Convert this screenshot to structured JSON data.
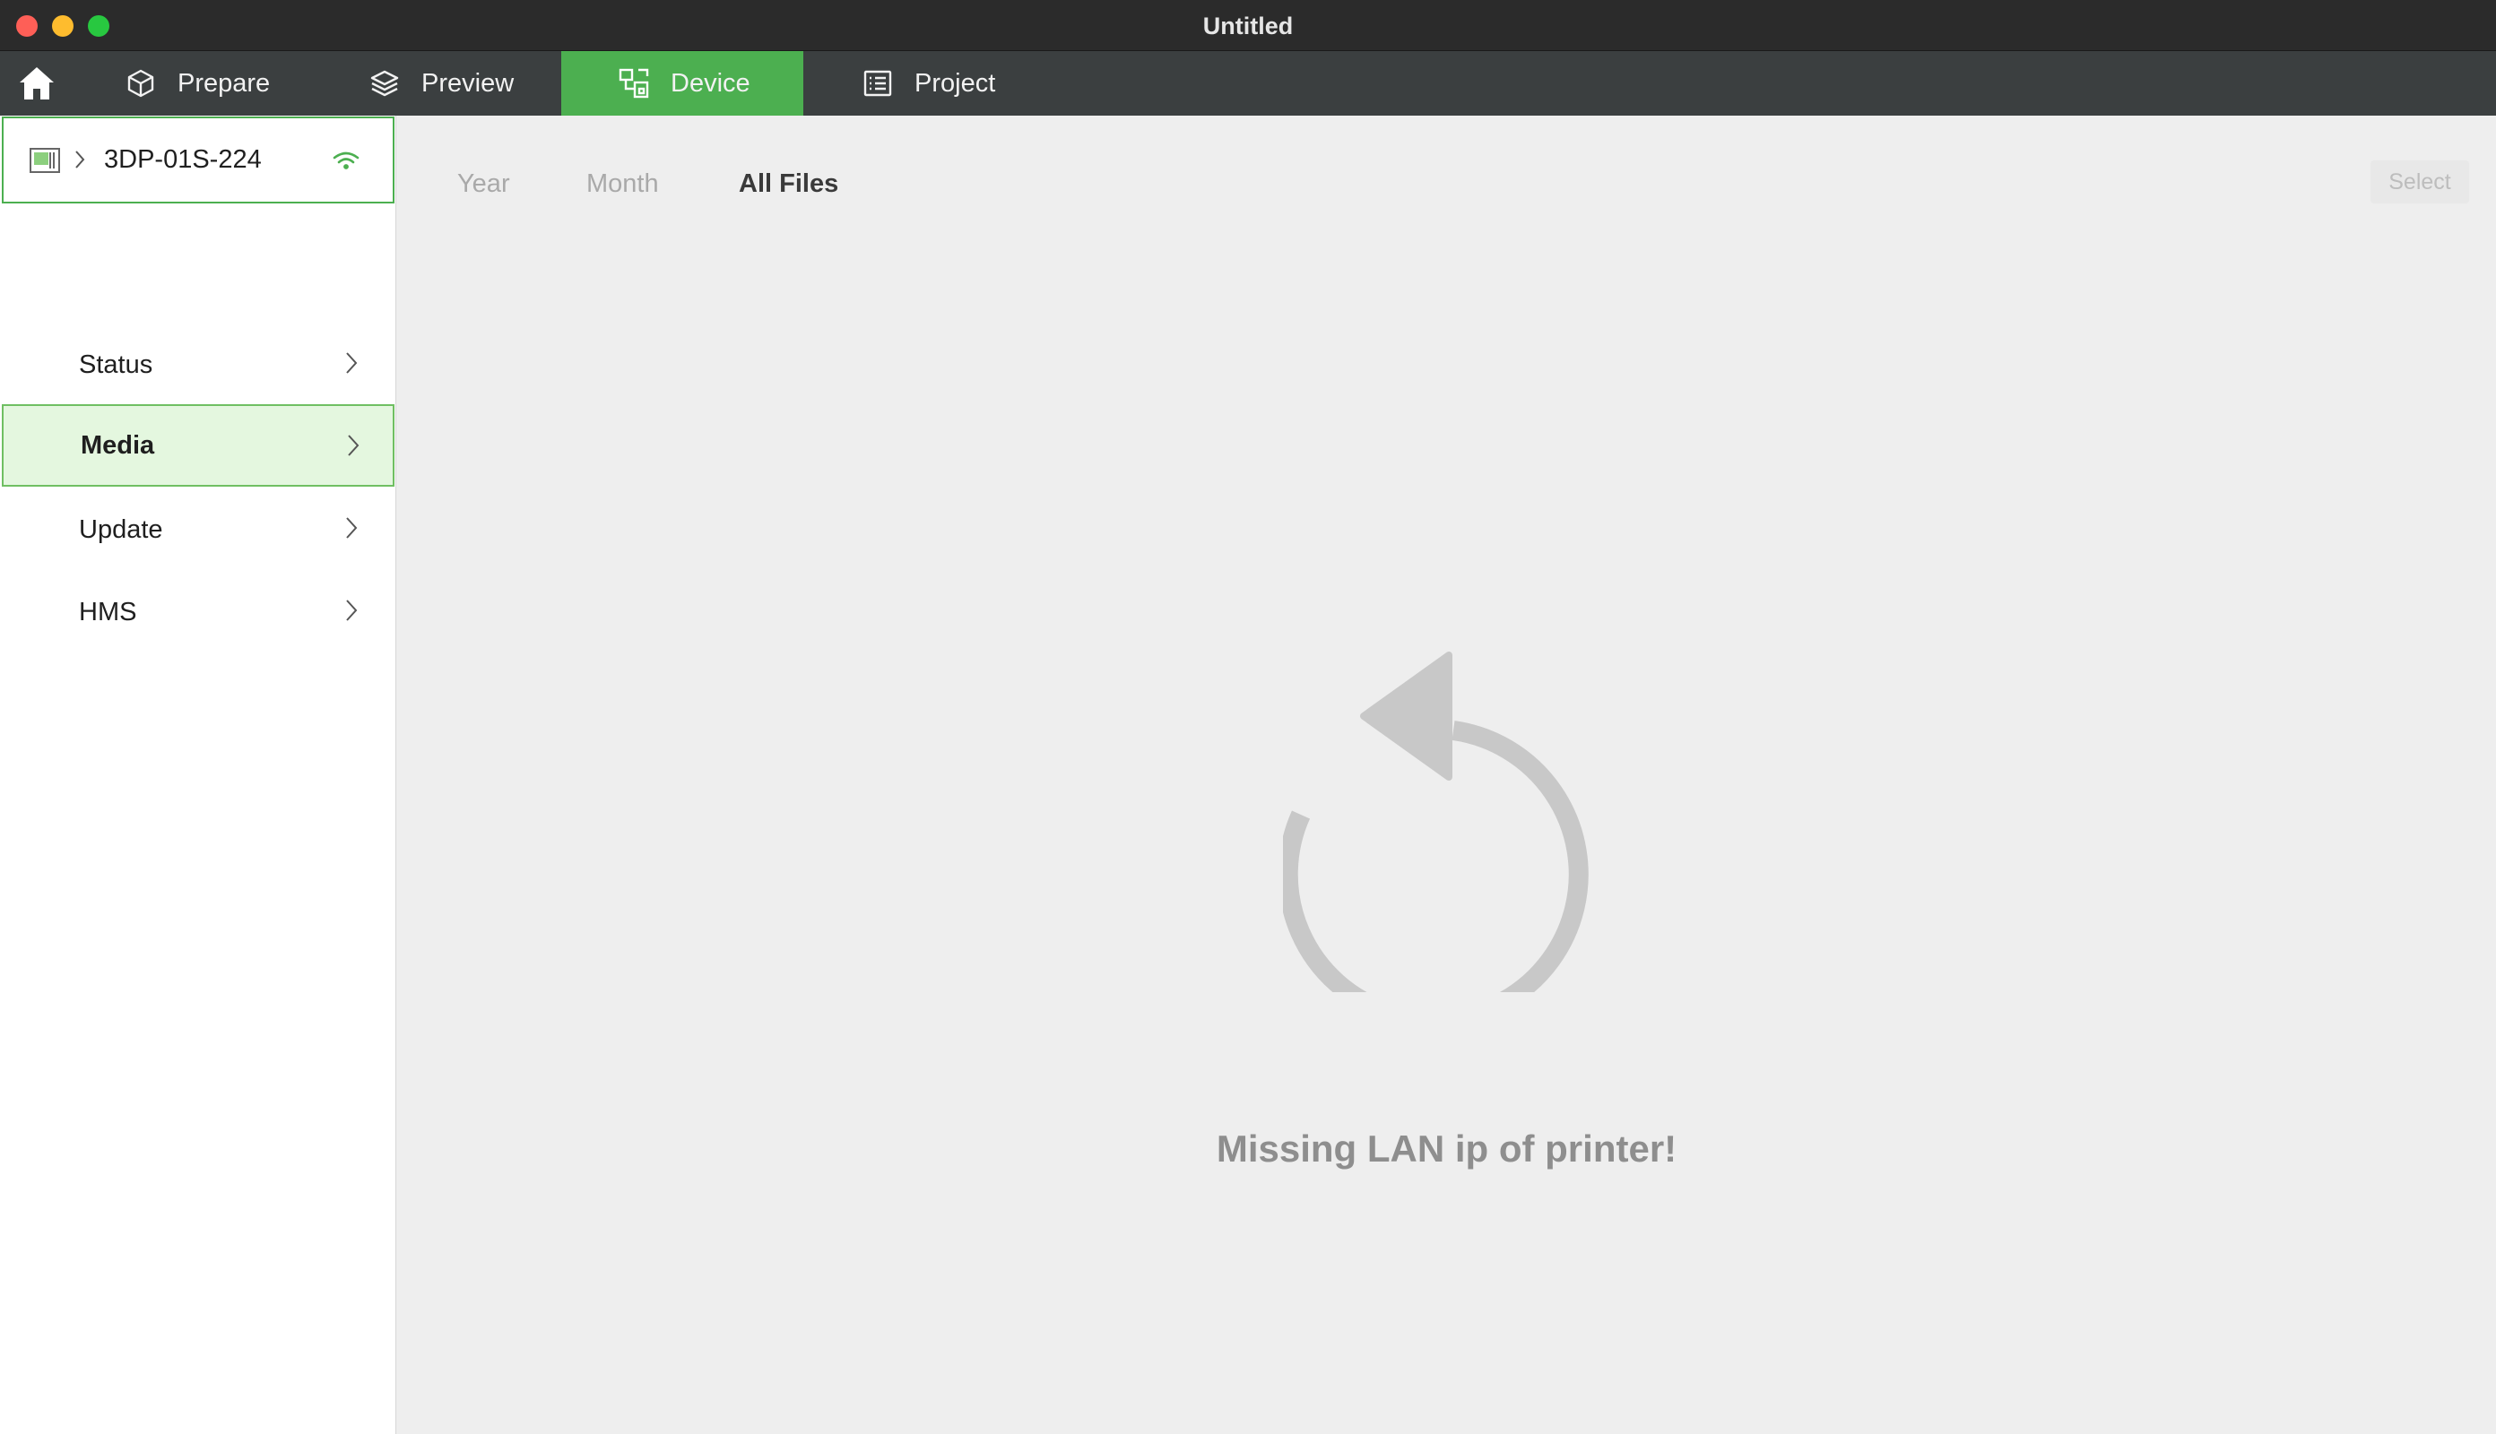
{
  "window": {
    "title": "Untitled"
  },
  "tabs": [
    {
      "label": "Prepare",
      "icon": "cube-icon"
    },
    {
      "label": "Preview",
      "icon": "layers-icon"
    },
    {
      "label": "Device",
      "icon": "device-icon",
      "active": true
    },
    {
      "label": "Project",
      "icon": "list-icon"
    }
  ],
  "sidebar": {
    "device_name": "3DP-01S-224",
    "items": [
      {
        "label": "Status"
      },
      {
        "label": "Media",
        "selected": true
      },
      {
        "label": "Update"
      },
      {
        "label": "HMS"
      }
    ]
  },
  "main": {
    "filters": [
      {
        "label": "Year"
      },
      {
        "label": "Month"
      },
      {
        "label": "All Files",
        "active": true
      }
    ],
    "select_label": "Select",
    "message": "Missing LAN ip of printer!"
  },
  "colors": {
    "accent": "#4caf50",
    "selected_bg": "#e4f7df",
    "tabbar_bg": "#3b3f40",
    "titlebar_bg": "#2b2b2b"
  }
}
